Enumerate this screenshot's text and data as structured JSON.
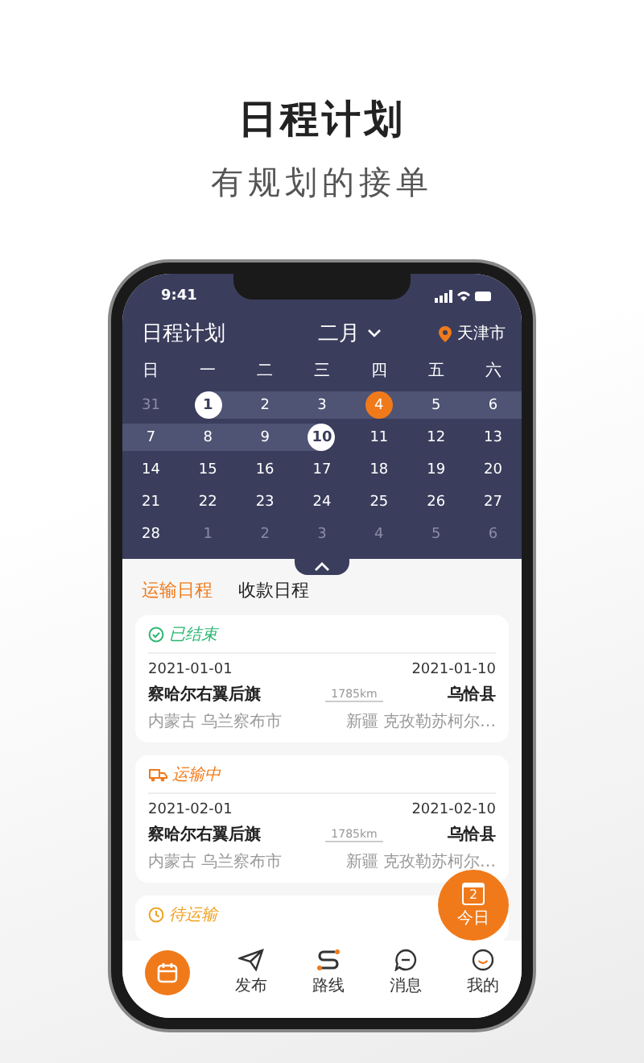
{
  "promo": {
    "title": "日程计划",
    "subtitle": "有规划的接单"
  },
  "status_bar": {
    "time": "9:41"
  },
  "header": {
    "title": "日程计划",
    "month": "二月",
    "city": "天津市"
  },
  "calendar": {
    "weekdays": [
      "日",
      "一",
      "二",
      "三",
      "四",
      "五",
      "六"
    ],
    "weeks": [
      [
        {
          "label": "31",
          "other_month": true,
          "in_range": false,
          "selected": false,
          "today": false
        },
        {
          "label": "1",
          "other_month": false,
          "in_range": true,
          "selected": true,
          "today": false
        },
        {
          "label": "2",
          "other_month": false,
          "in_range": true,
          "selected": false,
          "today": false
        },
        {
          "label": "3",
          "other_month": false,
          "in_range": true,
          "selected": false,
          "today": false
        },
        {
          "label": "4",
          "other_month": false,
          "in_range": true,
          "selected": false,
          "today": true
        },
        {
          "label": "5",
          "other_month": false,
          "in_range": true,
          "selected": false,
          "today": false
        },
        {
          "label": "6",
          "other_month": false,
          "in_range": true,
          "selected": false,
          "today": false
        }
      ],
      [
        {
          "label": "7",
          "other_month": false,
          "in_range": true,
          "selected": false,
          "today": false
        },
        {
          "label": "8",
          "other_month": false,
          "in_range": true,
          "selected": false,
          "today": false
        },
        {
          "label": "9",
          "other_month": false,
          "in_range": true,
          "selected": false,
          "today": false
        },
        {
          "label": "10",
          "other_month": false,
          "in_range": true,
          "selected": true,
          "today": false
        },
        {
          "label": "11",
          "other_month": false,
          "in_range": false,
          "selected": false,
          "today": false
        },
        {
          "label": "12",
          "other_month": false,
          "in_range": false,
          "selected": false,
          "today": false
        },
        {
          "label": "13",
          "other_month": false,
          "in_range": false,
          "selected": false,
          "today": false
        }
      ],
      [
        {
          "label": "14",
          "other_month": false,
          "in_range": false,
          "selected": false,
          "today": false
        },
        {
          "label": "15",
          "other_month": false,
          "in_range": false,
          "selected": false,
          "today": false
        },
        {
          "label": "16",
          "other_month": false,
          "in_range": false,
          "selected": false,
          "today": false
        },
        {
          "label": "17",
          "other_month": false,
          "in_range": false,
          "selected": false,
          "today": false
        },
        {
          "label": "18",
          "other_month": false,
          "in_range": false,
          "selected": false,
          "today": false
        },
        {
          "label": "19",
          "other_month": false,
          "in_range": false,
          "selected": false,
          "today": false
        },
        {
          "label": "20",
          "other_month": false,
          "in_range": false,
          "selected": false,
          "today": false
        }
      ],
      [
        {
          "label": "21",
          "other_month": false,
          "in_range": false,
          "selected": false,
          "today": false
        },
        {
          "label": "22",
          "other_month": false,
          "in_range": false,
          "selected": false,
          "today": false
        },
        {
          "label": "23",
          "other_month": false,
          "in_range": false,
          "selected": false,
          "today": false
        },
        {
          "label": "24",
          "other_month": false,
          "in_range": false,
          "selected": false,
          "today": false
        },
        {
          "label": "25",
          "other_month": false,
          "in_range": false,
          "selected": false,
          "today": false
        },
        {
          "label": "26",
          "other_month": false,
          "in_range": false,
          "selected": false,
          "today": false
        },
        {
          "label": "27",
          "other_month": false,
          "in_range": false,
          "selected": false,
          "today": false
        }
      ],
      [
        {
          "label": "28",
          "other_month": false,
          "in_range": false,
          "selected": false,
          "today": false
        },
        {
          "label": "1",
          "other_month": true,
          "in_range": false,
          "selected": false,
          "today": false
        },
        {
          "label": "2",
          "other_month": true,
          "in_range": false,
          "selected": false,
          "today": false
        },
        {
          "label": "3",
          "other_month": true,
          "in_range": false,
          "selected": false,
          "today": false
        },
        {
          "label": "4",
          "other_month": true,
          "in_range": false,
          "selected": false,
          "today": false
        },
        {
          "label": "5",
          "other_month": true,
          "in_range": false,
          "selected": false,
          "today": false
        },
        {
          "label": "6",
          "other_month": true,
          "in_range": false,
          "selected": false,
          "today": false
        }
      ]
    ]
  },
  "tabs": [
    {
      "label": "运输日程",
      "selected": true
    },
    {
      "label": "收款日程",
      "selected": false
    }
  ],
  "orders": [
    {
      "kind": "done",
      "status": "已结束",
      "start_date": "2021-01-01",
      "end_date": "2021-01-10",
      "from": "察哈尔右翼后旗",
      "from_region": "内蒙古 乌兰察布市",
      "distance": "1785km",
      "to": "乌恰县",
      "to_region": "新疆 克孜勒苏柯尔…"
    },
    {
      "kind": "transit",
      "status": "运输中",
      "start_date": "2021-02-01",
      "end_date": "2021-02-10",
      "from": "察哈尔右翼后旗",
      "from_region": "内蒙古 乌兰察布市",
      "distance": "1785km",
      "to": "乌恰县",
      "to_region": "新疆 克孜勒苏柯尔…"
    },
    {
      "kind": "pending",
      "status": "待运输"
    }
  ],
  "today_button": {
    "day": "2",
    "label": "今日"
  },
  "nav": [
    {
      "selected": true
    },
    {
      "label": "发布",
      "selected": false
    },
    {
      "label": "路线",
      "selected": false
    },
    {
      "label": "消息",
      "selected": false
    },
    {
      "label": "我的",
      "selected": false
    }
  ]
}
